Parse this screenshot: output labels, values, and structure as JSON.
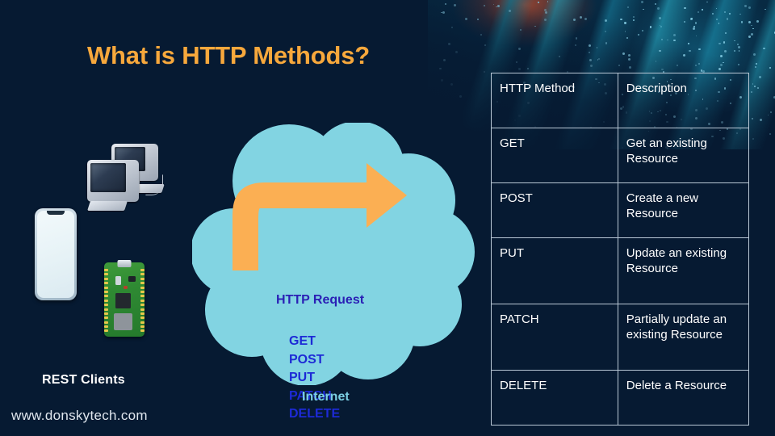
{
  "slide": {
    "title": "What is HTTP Methods?",
    "background_color": "#061a32",
    "accent_orange": "#f7a83c",
    "cloud_color": "#82d4e2",
    "method_blue": "#1d2ad6"
  },
  "left_panel": {
    "clients_label": "REST Clients",
    "website": "www.donskytech.com",
    "devices": [
      {
        "name": "desktop-computers",
        "label": "Desktop Computers"
      },
      {
        "name": "smartphone",
        "label": "Smartphone"
      },
      {
        "name": "microcontroller-board",
        "label": "Raspberry Pi Pico W"
      }
    ]
  },
  "cloud": {
    "label": "Internet",
    "arrow_label": "HTTP Request",
    "methods": [
      "GET",
      "POST",
      "PUT",
      "PATCH",
      "DELETE"
    ]
  },
  "table": {
    "headers": [
      "HTTP Method",
      "Description"
    ],
    "rows": [
      {
        "method": "GET",
        "description": "Get an existing Resource"
      },
      {
        "method": "POST",
        "description": "Create a new Resource"
      },
      {
        "method": "PUT",
        "description": "Update an existing Resource"
      },
      {
        "method": "PATCH",
        "description": "Partially update an existing Resource"
      },
      {
        "method": "DELETE",
        "description": "Delete a Resource"
      }
    ]
  }
}
